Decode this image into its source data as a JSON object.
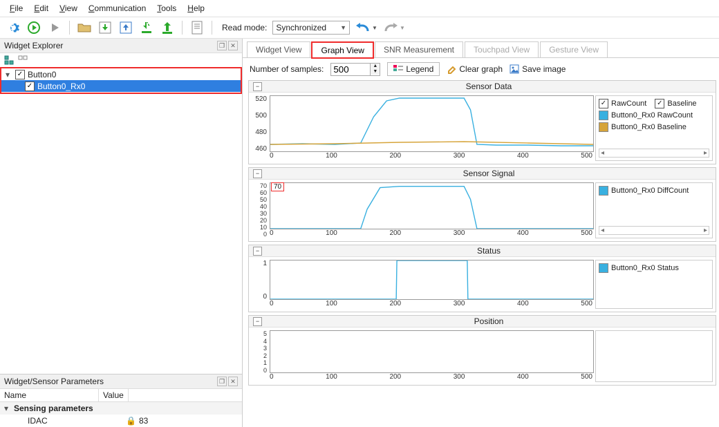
{
  "menubar": [
    "File",
    "Edit",
    "View",
    "Communication",
    "Tools",
    "Help"
  ],
  "toolbar": {
    "read_mode_lbl": "Read mode:",
    "read_mode_value": "Synchronized"
  },
  "sidebar": {
    "explorer": {
      "title": "Widget Explorer",
      "items": [
        {
          "label": "Button0",
          "checked": true,
          "selected": false
        },
        {
          "label": "Button0_Rx0",
          "checked": true,
          "selected": true
        }
      ]
    },
    "params": {
      "title": "Widget/Sensor Parameters",
      "col_name": "Name",
      "col_value": "Value",
      "group": "Sensing parameters",
      "rows": [
        {
          "k": "IDAC",
          "v": "83",
          "locked": true
        }
      ]
    }
  },
  "main": {
    "tabs": [
      "Widget View",
      "Graph View",
      "SNR Measurement",
      "Touchpad View",
      "Gesture View"
    ],
    "active_tab": 1,
    "gv_tool": {
      "samples_lbl": "Number of samples:",
      "samples_val": "500",
      "legend_btn": "Legend",
      "clear_btn": "Clear graph",
      "save_btn": "Save image"
    },
    "charts": [
      {
        "title": "Sensor Data",
        "y": [
          "520",
          "500",
          "480",
          "460"
        ],
        "x": [
          "0",
          "100",
          "200",
          "300",
          "400",
          "500"
        ],
        "legend_checks": [
          {
            "label": "RawCount",
            "checked": true
          },
          {
            "label": "Baseline",
            "checked": true
          }
        ],
        "legend_items": [
          {
            "color": "#39b0e0",
            "label": "Button0_Rx0 RawCount"
          },
          {
            "color": "#d6a43a",
            "label": "Button0_Rx0 Baseline"
          }
        ]
      },
      {
        "title": "Sensor Signal",
        "y": [
          "70",
          "60",
          "50",
          "40",
          "30",
          "20",
          "10",
          "0"
        ],
        "x": [
          "0",
          "100",
          "200",
          "300",
          "400",
          "500"
        ],
        "badge": "70",
        "legend_items": [
          {
            "color": "#39b0e0",
            "label": "Button0_Rx0 DiffCount"
          }
        ]
      },
      {
        "title": "Status",
        "y": [
          "1",
          "0"
        ],
        "x": [
          "0",
          "100",
          "200",
          "300",
          "400",
          "500"
        ],
        "legend_items": [
          {
            "color": "#39b0e0",
            "label": "Button0_Rx0 Status"
          }
        ]
      },
      {
        "title": "Position",
        "y": [
          "5",
          "4",
          "3",
          "2",
          "1",
          "0"
        ],
        "x": [
          "0",
          "100",
          "200",
          "300",
          "400",
          "500"
        ],
        "legend_items": []
      }
    ]
  },
  "chart_data": [
    {
      "type": "line",
      "title": "Sensor Data",
      "xlabel": "",
      "ylabel": "",
      "xlim": [
        0,
        500
      ],
      "ylim": [
        450,
        530
      ],
      "series": [
        {
          "name": "Button0_Rx0 RawCount",
          "color": "#39b0e0",
          "x": [
            0,
            50,
            100,
            140,
            160,
            180,
            200,
            250,
            300,
            310,
            320,
            350,
            400,
            450,
            500
          ],
          "y": [
            460,
            461,
            460,
            462,
            500,
            523,
            527,
            527,
            527,
            510,
            460,
            459,
            459,
            458,
            458
          ]
        },
        {
          "name": "Button0_Rx0 Baseline",
          "color": "#d6a43a",
          "x": [
            0,
            100,
            200,
            300,
            400,
            500
          ],
          "y": [
            460,
            461,
            463,
            464,
            462,
            460
          ]
        }
      ]
    },
    {
      "type": "line",
      "title": "Sensor Signal",
      "xlabel": "",
      "ylabel": "",
      "xlim": [
        0,
        500
      ],
      "ylim": [
        0,
        70
      ],
      "series": [
        {
          "name": "Button0_Rx0 DiffCount",
          "color": "#39b0e0",
          "x": [
            0,
            140,
            150,
            170,
            200,
            250,
            300,
            310,
            320,
            500
          ],
          "y": [
            0,
            0,
            30,
            63,
            65,
            65,
            65,
            45,
            0,
            0
          ]
        }
      ]
    },
    {
      "type": "line",
      "title": "Status",
      "xlabel": "",
      "ylabel": "",
      "xlim": [
        0,
        500
      ],
      "ylim": [
        0,
        1
      ],
      "series": [
        {
          "name": "Button0_Rx0 Status",
          "color": "#39b0e0",
          "x": [
            0,
            195,
            196,
            305,
            306,
            500
          ],
          "y": [
            0,
            0,
            1,
            1,
            0,
            0
          ]
        }
      ]
    },
    {
      "type": "line",
      "title": "Position",
      "xlabel": "",
      "ylabel": "",
      "xlim": [
        0,
        500
      ],
      "ylim": [
        0,
        5
      ],
      "series": []
    }
  ]
}
